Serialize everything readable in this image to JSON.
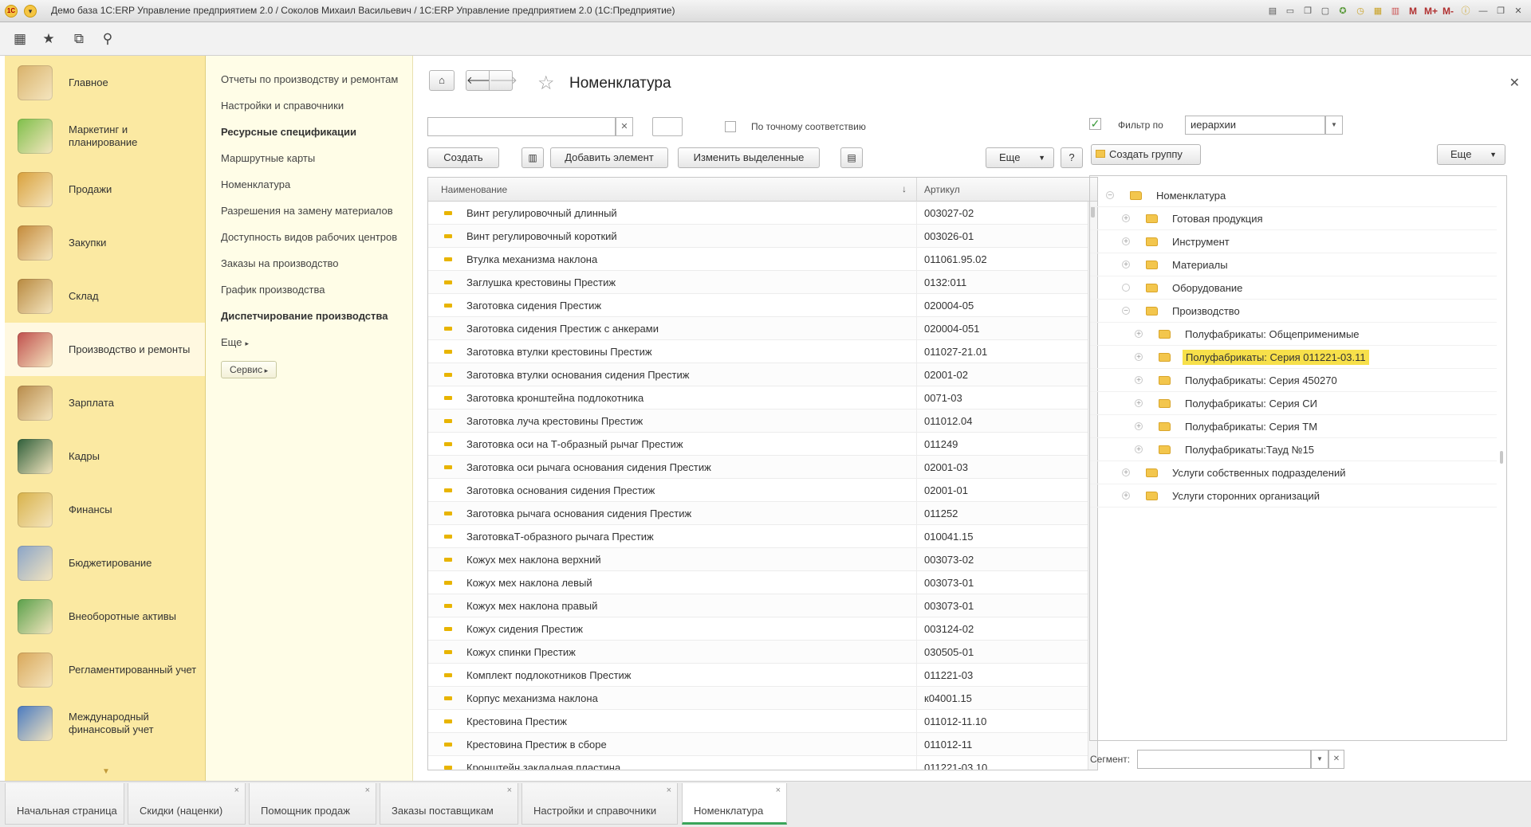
{
  "window": {
    "title": "Демо база 1С:ERP Управление предприятием 2.0 / Соколов Михаил Васильевич / 1С:ERP Управление предприятием 2.0  (1С:Предприятие)",
    "logo": "1С",
    "toolbar_icons": [
      "save-icon",
      "print-icon",
      "copy-icon",
      "paste-icon",
      "favorite-icon",
      "history-icon",
      "calculator-icon",
      "calendar-icon"
    ],
    "m_buttons": [
      "M",
      "M+",
      "M-"
    ]
  },
  "sections": [
    {
      "label": "Главное",
      "icon": "home-desk-icon",
      "color": "#d9b26a"
    },
    {
      "label": "Маркетинг и\nпланирование",
      "icon": "pie-chart-icon",
      "color": "#7fbf4a"
    },
    {
      "label": "Продажи",
      "icon": "truck-icon",
      "color": "#d9a13c"
    },
    {
      "label": "Закупки",
      "icon": "boxes-icon",
      "color": "#c48a3a"
    },
    {
      "label": "Склад",
      "icon": "warehouse-icon",
      "color": "#b8893f"
    },
    {
      "label": "Производство и ремонты",
      "icon": "factory-icon",
      "color": "#c0504d",
      "active": true
    },
    {
      "label": "Зарплата",
      "icon": "abacus-icon",
      "color": "#b88b4a"
    },
    {
      "label": "Кадры",
      "icon": "passport-icon",
      "color": "#2f5f3a"
    },
    {
      "label": "Финансы",
      "icon": "coins-icon",
      "color": "#d8b24a"
    },
    {
      "label": "Бюджетирование",
      "icon": "documents-icon",
      "color": "#8aa4c8"
    },
    {
      "label": "Внеоборотные активы",
      "icon": "assets-icon",
      "color": "#5aa04a"
    },
    {
      "label": "Регламентированный учет",
      "icon": "ledger-icon",
      "color": "#d9a85a"
    },
    {
      "label": "Международный\nфинансовый учет",
      "icon": "globe-dollar-icon",
      "color": "#4a7ac0"
    }
  ],
  "subnav": [
    {
      "label": "Отчеты по производству и ремонтам",
      "bold": false
    },
    {
      "label": "Настройки и справочники",
      "bold": false
    },
    {
      "label": "Ресурсные спецификации",
      "bold": true
    },
    {
      "label": "Маршрутные карты",
      "bold": false
    },
    {
      "label": "Номенклатура",
      "bold": false
    },
    {
      "label": "Разрешения на замену материалов",
      "bold": false
    },
    {
      "label": "Доступность видов рабочих центров",
      "bold": false
    },
    {
      "label": "Заказы на производство",
      "bold": false
    },
    {
      "label": "График производства",
      "bold": false
    },
    {
      "label": "Диспетчирование производства",
      "bold": true
    },
    {
      "label": "Еще",
      "bold": false
    }
  ],
  "service_button": "Сервис",
  "form": {
    "title": "Номенклатура",
    "search_value": "",
    "exact_match_label": "По точному соответствию",
    "create_label": "Создать",
    "add_element_label": "Добавить элемент",
    "edit_selected_label": "Изменить выделенные",
    "more_label": "Еще",
    "help_label": "?",
    "filter_label": "Фильтр по",
    "filter_value": "иерархии",
    "create_group_label": "Создать группу",
    "tree_more_label": "Еще",
    "segment_label": "Сегмент:",
    "segment_value": ""
  },
  "grid": {
    "columns": [
      "Наименование",
      "Артикул"
    ],
    "sort_indicator": "↓",
    "rows": [
      {
        "name": "Винт регулировочный длинный",
        "art": "003027-02"
      },
      {
        "name": "Винт регулировочный короткий",
        "art": "003026-01"
      },
      {
        "name": "Втулка механизма наклона",
        "art": "011061.95.02"
      },
      {
        "name": "Заглушка крестовины Престиж",
        "art": "0132:011"
      },
      {
        "name": "Заготовка  сидения Престиж",
        "art": "020004-05"
      },
      {
        "name": "Заготовка  сидения Престиж с анкерами",
        "art": "020004-051"
      },
      {
        "name": "Заготовка втулки крестовины Престиж",
        "art": "011027-21.01"
      },
      {
        "name": "Заготовка втулки основания сидения Престиж",
        "art": "02001-02"
      },
      {
        "name": "Заготовка кронштейна подлокотника",
        "art": "0071-03"
      },
      {
        "name": "Заготовка луча крестовины Престиж",
        "art": "011012.04"
      },
      {
        "name": "Заготовка оси на Т-образный рычаг Престиж",
        "art": "011249"
      },
      {
        "name": "Заготовка оси рычага основания сидения Престиж",
        "art": "02001-03"
      },
      {
        "name": "Заготовка основания сидения Престиж",
        "art": "02001-01"
      },
      {
        "name": "Заготовка рычага основания сидения Престиж",
        "art": "011252"
      },
      {
        "name": "ЗаготовкаТ-образного рычага Престиж",
        "art": "010041.15"
      },
      {
        "name": "Кожух мех наклона верхний",
        "art": "003073-02"
      },
      {
        "name": "Кожух мех наклона левый",
        "art": "003073-01"
      },
      {
        "name": "Кожух мех наклона правый",
        "art": "003073-01"
      },
      {
        "name": "Кожух сидения Престиж",
        "art": "003124-02"
      },
      {
        "name": "Кожух спинки Престиж",
        "art": "030505-01"
      },
      {
        "name": "Комплект подлокотников Престиж",
        "art": "011221-03"
      },
      {
        "name": "Корпус механизма наклона",
        "art": "к04001.15"
      },
      {
        "name": "Крестовина  Престиж",
        "art": "011012-11.10"
      },
      {
        "name": "Крестовина  Престиж в сборе",
        "art": "011012-11"
      },
      {
        "name": "Кронштейн закладная пластина",
        "art": "011221-03.10"
      }
    ]
  },
  "tree": [
    {
      "label": "Номенклатура",
      "level": 0,
      "expander": "−"
    },
    {
      "label": "Готовая продукция",
      "level": 1,
      "expander": "+"
    },
    {
      "label": "Инструмент",
      "level": 1,
      "expander": "+"
    },
    {
      "label": "Материалы",
      "level": 1,
      "expander": "+"
    },
    {
      "label": "Оборудование",
      "level": 1,
      "expander": ""
    },
    {
      "label": "Производство",
      "level": 1,
      "expander": "−"
    },
    {
      "label": "Полуфабрикаты: Общеприменимые",
      "level": 2,
      "expander": "+"
    },
    {
      "label": "Полуфабрикаты: Серия 011221-03.11",
      "level": 2,
      "expander": "+",
      "selected": true
    },
    {
      "label": "Полуфабрикаты: Серия 450270",
      "level": 2,
      "expander": "+"
    },
    {
      "label": "Полуфабрикаты: Серия СИ",
      "level": 2,
      "expander": "+"
    },
    {
      "label": "Полуфабрикаты: Серия ТМ",
      "level": 2,
      "expander": "+"
    },
    {
      "label": "Полуфабрикаты:Тауд №15",
      "level": 2,
      "expander": "+"
    },
    {
      "label": "Услуги собственных подразделений",
      "level": 1,
      "expander": "+"
    },
    {
      "label": "Услуги сторонних организаций",
      "level": 1,
      "expander": "+"
    }
  ],
  "tabs": [
    {
      "label": "Начальная страница",
      "closable": false
    },
    {
      "label": "Скидки (наценки)",
      "closable": true
    },
    {
      "label": "Помощник продаж",
      "closable": true
    },
    {
      "label": "Заказы поставщикам",
      "closable": true
    },
    {
      "label": "Настройки и справочники",
      "closable": true
    },
    {
      "label": "Номенклатура",
      "closable": true,
      "active": true
    }
  ]
}
